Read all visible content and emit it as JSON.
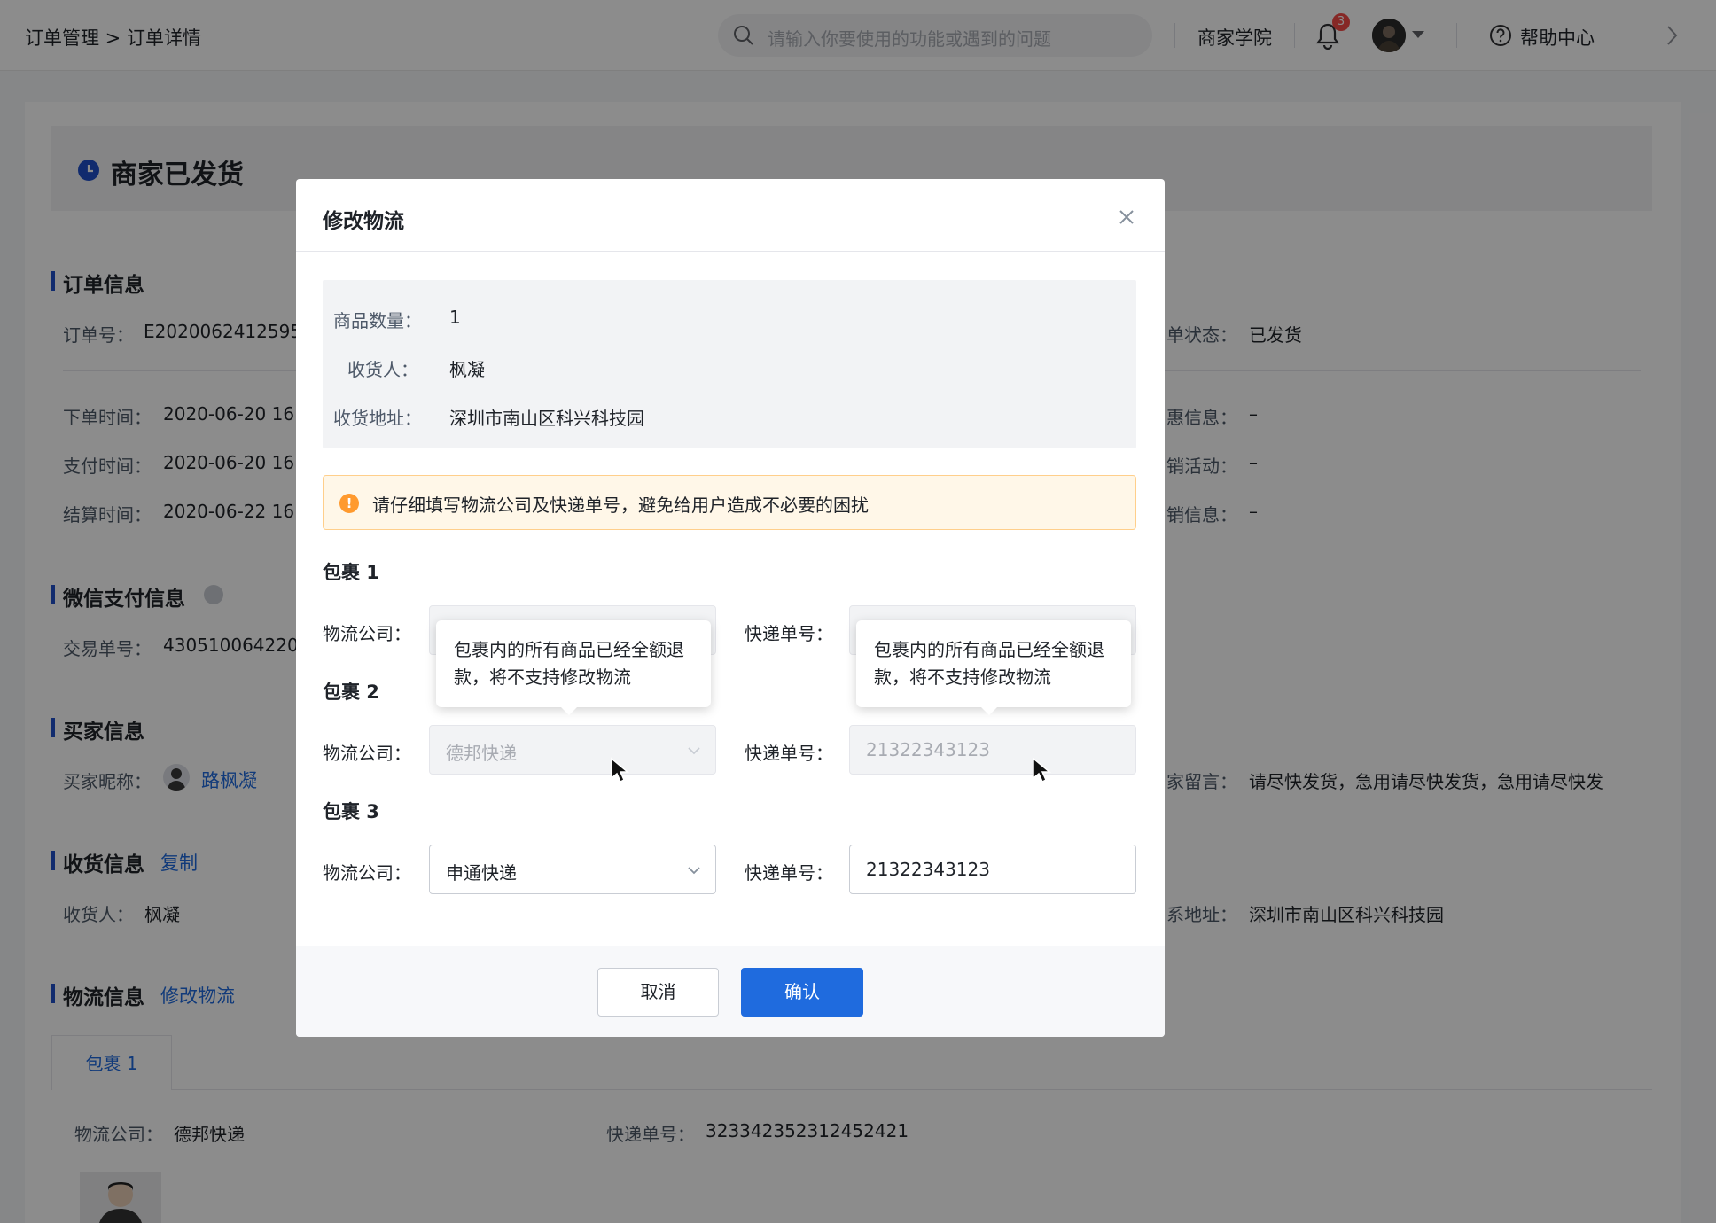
{
  "topbar": {
    "breadcrumb": "订单管理 > 订单详情",
    "search_placeholder": "请输入你要使用的功能或遇到的问题",
    "academy": "商家学院",
    "notifications": "3",
    "help": "帮助中心"
  },
  "status": {
    "title": "商家已发货"
  },
  "order": {
    "section": "订单信息",
    "order_no_label": "订单号：",
    "order_no": "E2020062412595",
    "order_status_label": "单状态：",
    "order_status": "已发货",
    "place_time_label": "下单时间：",
    "place_time": "2020-06-20 16",
    "pay_time_label": "支付时间：",
    "pay_time": "2020-06-20 16",
    "settle_time_label": "结算时间：",
    "settle_time": "2020-06-22 16",
    "discount_label": "惠信息：",
    "discount": "–",
    "promo_label": "销活动：",
    "promo": "–",
    "promo_info_label": "销信息：",
    "promo_info": "–"
  },
  "wechat": {
    "section": "微信支付信息",
    "trade_label": "交易单号：",
    "trade_no": "430510064220"
  },
  "buyer": {
    "section": "买家信息",
    "nick_label": "买家昵称：",
    "nick": "路枫凝",
    "msg_label": "家留言：",
    "msg": "请尽快发货，急用请尽快发货，急用请尽快发"
  },
  "shipping": {
    "section": "收货信息",
    "copy": "复制",
    "receiver_label": "收货人：",
    "receiver": "枫凝",
    "address_label": "系地址：",
    "address": "深圳市南山区科兴科技园"
  },
  "logistics": {
    "section": "物流信息",
    "edit": "修改物流",
    "tab": "包裹 1",
    "company_label": "物流公司：",
    "company": "德邦快递",
    "tracking_label": "快递单号：",
    "tracking": "323342352312452421"
  },
  "modal": {
    "title": "修改物流",
    "qty_label": "商品数量：",
    "qty": "1",
    "receiver_label": "收货人：",
    "receiver": "枫凝",
    "address_label": "收货地址：",
    "address": "深圳市南山区科兴科技园",
    "notice": "请仔细填写物流公司及快递单号，避免给用户造成不必要的困扰",
    "company_label": "物流公司：",
    "tracking_label": "快递单号：",
    "tooltip": "包裹内的所有商品已经全额退款，将不支持修改物流",
    "packages": [
      {
        "title": "包裹 1",
        "company": "",
        "tracking": ""
      },
      {
        "title": "包裹 2",
        "company": "德邦快递",
        "tracking": "21322343123"
      },
      {
        "title": "包裹 3",
        "company": "申通快递",
        "tracking": "21322343123"
      }
    ],
    "cancel": "取消",
    "confirm": "确认"
  },
  "colors": {
    "accent": "#1f6bde",
    "status_dot": "#1f4fc8",
    "notice_bg": "#fff7e8",
    "warning": "#ff9a2e",
    "badge": "#f54a45"
  }
}
